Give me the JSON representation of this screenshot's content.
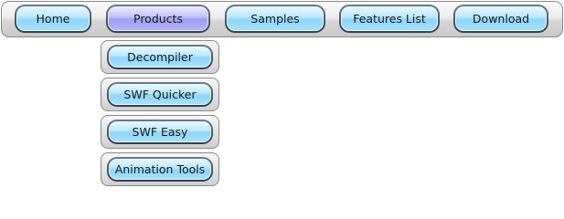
{
  "menu": {
    "items": [
      {
        "label": "Home",
        "active": false
      },
      {
        "label": "Products",
        "active": true
      },
      {
        "label": "Samples",
        "active": false
      },
      {
        "label": "Features List",
        "active": false
      },
      {
        "label": "Download",
        "active": false
      }
    ]
  },
  "submenu": {
    "parent": "Products",
    "items": [
      {
        "label": "Decompiler"
      },
      {
        "label": "SWF Quicker"
      },
      {
        "label": "SWF Easy"
      },
      {
        "label": "Animation Tools"
      }
    ]
  },
  "colors": {
    "button_blue": "#8fd6fb",
    "button_active_purple": "#9e9ef4",
    "frame_dark": "#2d3f52",
    "bar_silver": "#d6d6d6"
  }
}
